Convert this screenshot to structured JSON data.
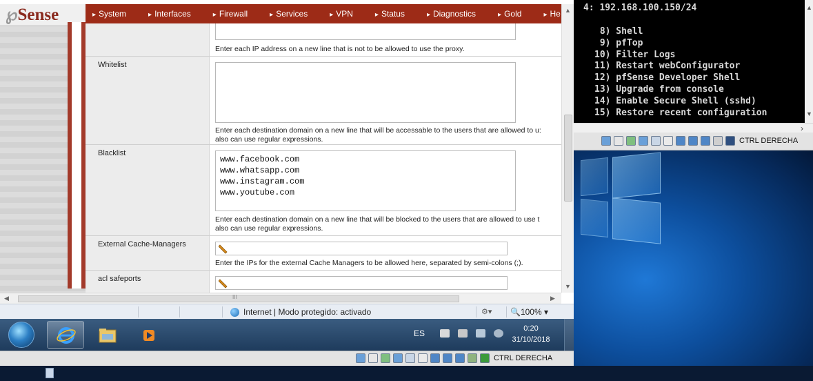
{
  "pfsense": {
    "logo_mark": "℘",
    "logo_text": "Sense",
    "menu": [
      "System",
      "Interfaces",
      "Firewall",
      "Services",
      "VPN",
      "Status",
      "Diagnostics",
      "Gold",
      "He"
    ],
    "blacklist_ip_hint": "Enter each IP address on a new line that is not to be allowed to use the proxy.",
    "whitelist": {
      "label": "Whitelist",
      "value": "",
      "hint_line1": "Enter each destination domain on a new line that will be accessable to the users that are allowed to u:",
      "hint_line2": "also can use regular expressions."
    },
    "blacklist": {
      "label": "Blacklist",
      "value": "www.facebook.com\nwww.whatsapp.com\nwww.instagram.com\nwww.youtube.com",
      "hint_line1": "Enter each destination domain on a new line that will be blocked to the users that are allowed to use t",
      "hint_line2": "also can use regular expressions."
    },
    "external_cache": {
      "label": "External Cache-Managers",
      "hint": "Enter the IPs for the external Cache Managers to be allowed here, separated by semi-colons (;)."
    },
    "acl_safeports": {
      "label": "acl safeports"
    },
    "hscroll_grip": "III"
  },
  "browser_status": {
    "zone_text": "Internet | Modo protegido: activado",
    "zoom": "100%"
  },
  "taskbar": {
    "lang": "ES",
    "time": "0:20",
    "date": "31/10/2018"
  },
  "vm_toolbar": {
    "ctrl_label": "CTRL DERECHA"
  },
  "console": {
    "top_line": "4: 192.168.100.150/24",
    "menu": [
      " 8) Shell",
      " 9) pfTop",
      "10) Filter Logs",
      "11) Restart webConfigurator",
      "12) pfSense Developer Shell",
      "13) Upgrade from console",
      "14) Enable Secure Shell (sshd)",
      "15) Restore recent configuration"
    ]
  },
  "colors": {
    "pfsense_red": "#9d2b17",
    "console_bg": "#000000",
    "win_taskbar": "#1e3b5c",
    "win10_blue": "#0d4f9e"
  },
  "icons": [
    "pencil-icon",
    "globe-icon",
    "start-orb-icon",
    "ie-icon",
    "explorer-icon",
    "media-player-icon",
    "flag-icon",
    "network-icon",
    "volume-icon"
  ]
}
